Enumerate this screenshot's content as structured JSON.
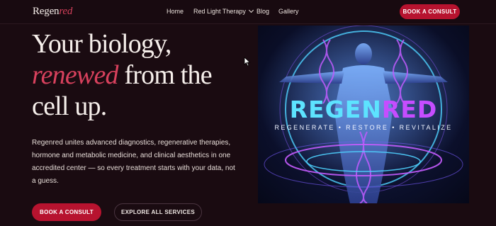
{
  "header": {
    "logo_main": "Regen",
    "logo_accent": "red",
    "nav": [
      {
        "label": "Home"
      },
      {
        "label": "Red Light Therapy"
      },
      {
        "label": "Blog"
      },
      {
        "label": "Gallery"
      }
    ],
    "cta_label": "BOOK A CONSULT"
  },
  "hero": {
    "line1": "Your biology,",
    "line2_em": "renewed",
    "line2_rest": " from the",
    "line3": "cell up.",
    "description": "Regenred unites advanced diagnostics, regenerative therapies, hormone and metabolic medicine, and clinical aesthetics in one accredited center — so every treatment starts with your data, not a guess.",
    "primary_button": "BOOK A CONSULT",
    "secondary_button": "EXPLORE ALL SERVICES",
    "image": {
      "brand_part1": "REGEN",
      "brand_part2": "RED",
      "tagline": "REGENERATE • RESTORE • REVITALIZE"
    }
  },
  "colors": {
    "background": "#1a0b11",
    "accent": "#b7132f",
    "accent_text": "#d8415d"
  }
}
